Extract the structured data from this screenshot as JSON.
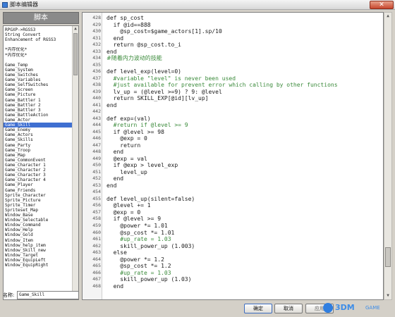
{
  "window": {
    "title": "脚本编辑器",
    "close_label": "✕"
  },
  "left": {
    "header": "脚本",
    "scripts": [
      "RPGXP->RGSS3",
      "String Convert",
      "Enhancement of RGSS3",
      "",
      "*内存优化*",
      "*内存优化*",
      "",
      "Game_Temp",
      "Game_System",
      "Game_Switches",
      "Game_Variables",
      "Game_SelfSwitches",
      "Game_Screen",
      "Game_Picture",
      "Game_Battler 1",
      "Game_Battler 2",
      "Game_Battler 3",
      "Game_BattleAction",
      "Game_Actor",
      "Game_Skill",
      "Game_Enemy",
      "Game_Actors",
      "Game_Skills",
      "Game_Party",
      "Game_Troop",
      "Game_Map",
      "Game_CommonEvent",
      "Game_Character 1",
      "Game_Character 2",
      "Game_Character 3",
      "Game_Character 4",
      "Game_Player",
      "Game_Friends",
      "Sprite_Character",
      "Sprite_Picture",
      "Sprite_Timer",
      "Spriteset_Map",
      "Window_Base",
      "Window_Selectable",
      "Window_Command",
      "Window_Help",
      "Window_Gold",
      "Window_Item",
      "Window_help_item",
      "Window_Skill_new",
      "Window_Target",
      "Window_EquipLeft",
      "Window_EquipRight"
    ],
    "selected_index": 19,
    "name_label": "名称:",
    "name_value": "Game_Skill"
  },
  "code": {
    "lines": [
      {
        "no": "428",
        "text": "def sp_cost",
        "kind": "code"
      },
      {
        "no": "429",
        "text": "  if @id==888",
        "kind": "code"
      },
      {
        "no": "430",
        "text": "    @sp_cost=$game_actors[1].sp/10",
        "kind": "code"
      },
      {
        "no": "431",
        "text": "  end",
        "kind": "code"
      },
      {
        "no": "432",
        "text": "  return @sp_cost.to_i",
        "kind": "code"
      },
      {
        "no": "433",
        "text": "end",
        "kind": "code"
      },
      {
        "no": "434",
        "text": "#随着内力波动的技能",
        "kind": "comment-cn"
      },
      {
        "no": "435",
        "text": "",
        "kind": "code"
      },
      {
        "no": "436",
        "text": "def level_exp(level=0)",
        "kind": "code"
      },
      {
        "no": "437",
        "text": "  #variable \"level\" is never been used",
        "kind": "comment"
      },
      {
        "no": "438",
        "text": "  #just available for prevent error which calling by other functions",
        "kind": "comment"
      },
      {
        "no": "439",
        "text": "  lv_up = (@level >=9) ? 9: @level",
        "kind": "code"
      },
      {
        "no": "440",
        "text": "  return SKILL_EXP[@id][lv_up]",
        "kind": "code"
      },
      {
        "no": "441",
        "text": "end",
        "kind": "code"
      },
      {
        "no": "442",
        "text": "",
        "kind": "code"
      },
      {
        "no": "443",
        "text": "def exp=(val)",
        "kind": "code"
      },
      {
        "no": "444",
        "text": "  #return if @level >= 9",
        "kind": "comment"
      },
      {
        "no": "445",
        "text": "  if @level >= 98",
        "kind": "code"
      },
      {
        "no": "446",
        "text": "    @exp = 0",
        "kind": "code"
      },
      {
        "no": "447",
        "text": "    return",
        "kind": "code"
      },
      {
        "no": "448",
        "text": "  end",
        "kind": "code"
      },
      {
        "no": "449",
        "text": "  @exp = val",
        "kind": "code"
      },
      {
        "no": "450",
        "text": "  if @exp > level_exp",
        "kind": "code"
      },
      {
        "no": "451",
        "text": "    level_up",
        "kind": "code"
      },
      {
        "no": "452",
        "text": "  end",
        "kind": "code"
      },
      {
        "no": "453",
        "text": "end",
        "kind": "code"
      },
      {
        "no": "454",
        "text": "",
        "kind": "code"
      },
      {
        "no": "455",
        "text": "def level_up(silent=false)",
        "kind": "code"
      },
      {
        "no": "456",
        "text": "  @level += 1",
        "kind": "code"
      },
      {
        "no": "457",
        "text": "  @exp = 0",
        "kind": "code"
      },
      {
        "no": "458",
        "text": "  if @level >= 9",
        "kind": "code"
      },
      {
        "no": "459",
        "text": "    @power *= 1.01",
        "kind": "code"
      },
      {
        "no": "460",
        "text": "    @sp_cost *= 1.01",
        "kind": "code"
      },
      {
        "no": "461",
        "text": "    #up_rate = 1.03",
        "kind": "comment"
      },
      {
        "no": "462",
        "text": "    skill_power_up (1.003)",
        "kind": "code"
      },
      {
        "no": "463",
        "text": "  else",
        "kind": "code"
      },
      {
        "no": "464",
        "text": "    @power *= 1.2",
        "kind": "code"
      },
      {
        "no": "465",
        "text": "    @sp_cost *= 1.2",
        "kind": "code"
      },
      {
        "no": "466",
        "text": "    #up_rate = 1.03",
        "kind": "comment"
      },
      {
        "no": "467",
        "text": "    skill_power_up (1.03)",
        "kind": "code"
      },
      {
        "no": "468",
        "text": "  end",
        "kind": "code"
      }
    ]
  },
  "buttons": {
    "ok": "确定",
    "cancel": "取消",
    "apply": "应用"
  },
  "watermark": {
    "main": "3DM",
    "sub": "GAME"
  }
}
